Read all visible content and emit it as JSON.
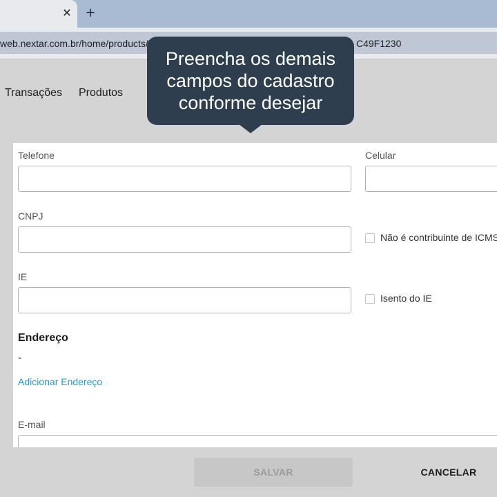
{
  "browser": {
    "close_glyph": "✕",
    "new_tab_glyph": "+",
    "url_left": "web.nextar.com.br/home/products/",
    "url_right": "C49F1230"
  },
  "nav": {
    "items": [
      "Transações",
      "Produtos"
    ]
  },
  "tooltip": {
    "line1": "Preencha os demais",
    "line2": "campos do cadastro",
    "line3": "conforme desejar"
  },
  "form": {
    "telefone_label": "Telefone",
    "celular_label": "Celular",
    "cnpj_label": "CNPJ",
    "nao_contribuinte_label": "Não é contribuinte de ICMS",
    "ie_label": "IE",
    "isento_ie_label": "Isento do IE",
    "endereco_title": "Endereço",
    "endereco_value": "-",
    "add_endereco_link": "Adicionar Endereço",
    "email_label": "E-mail"
  },
  "footer": {
    "save_label": "SALVAR",
    "cancel_label": "CANCELAR"
  },
  "colors": {
    "tooltip_bg": "#2f3e4e",
    "link": "#1aa0d8",
    "tabbar": "#a9bad3"
  }
}
